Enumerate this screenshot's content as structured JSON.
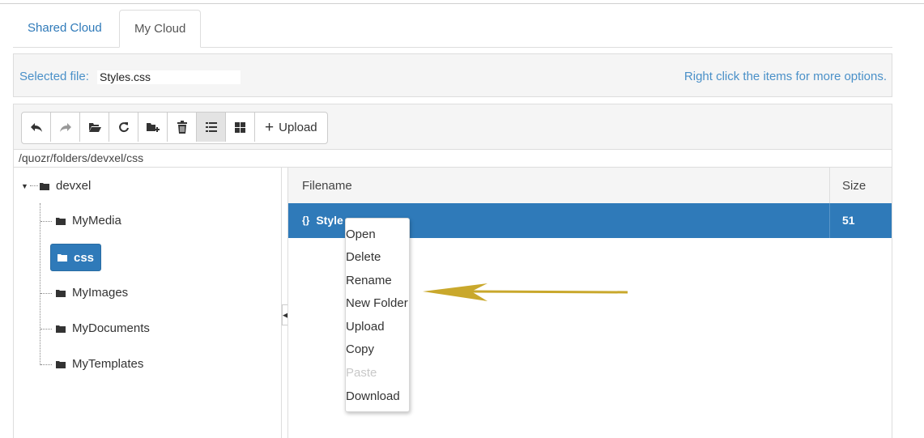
{
  "tabs": [
    {
      "label": "Shared Cloud"
    },
    {
      "label": "My Cloud"
    }
  ],
  "selected_file": {
    "label": "Selected file:",
    "value": "Styles.css",
    "hint": "Right click the items for more options."
  },
  "toolbar": {
    "buttons": [
      {
        "icon": "reply-icon"
      },
      {
        "icon": "forward-icon"
      },
      {
        "icon": "open-folder-icon"
      },
      {
        "icon": "refresh-icon"
      },
      {
        "icon": "new-folder-icon"
      },
      {
        "icon": "trash-icon"
      },
      {
        "icon": "list-view-icon",
        "active": true
      },
      {
        "icon": "grid-view-icon"
      }
    ],
    "upload_label": "Upload"
  },
  "path": "/quozr/folders/devxel/css",
  "tree": {
    "root": "devxel",
    "children": [
      "MyMedia",
      "css",
      "MyImages",
      "MyDocuments",
      "MyTemplates"
    ],
    "selected": "css"
  },
  "file_list": {
    "columns": [
      "Filename",
      "Size"
    ],
    "rows": [
      {
        "name": "Style",
        "size": "51",
        "icon": "braces-icon"
      }
    ]
  },
  "context_menu": {
    "items": [
      {
        "label": "Open"
      },
      {
        "label": "Delete"
      },
      {
        "label": "Rename"
      },
      {
        "label": "New Folder"
      },
      {
        "label": "Upload"
      },
      {
        "label": "Copy"
      },
      {
        "label": "Paste",
        "disabled": true
      },
      {
        "label": "Download"
      }
    ]
  },
  "colors": {
    "accent": "#2f7ab9",
    "link": "#4a90c8",
    "annotation_arrow": "#c9a82c"
  }
}
